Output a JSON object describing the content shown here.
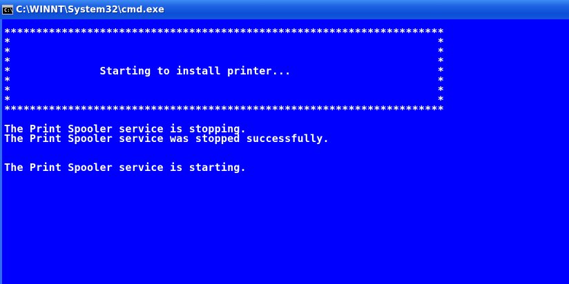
{
  "window": {
    "title": "C:\\WINNT\\System32\\cmd.exe",
    "icon": "cmd-console-icon",
    "background_color": "#0000ff",
    "text_color": "#ffffff"
  },
  "console": {
    "lines": [
      "*********************************************************************",
      "*                                                                   *",
      "*                                                                   *",
      "*                                                                   *",
      "*              Starting to install printer...                       *",
      "*                                                                   *",
      "*                                                                   *",
      "*                                                                   *",
      "*********************************************************************",
      "",
      "The Print Spooler service is stopping.",
      "The Print Spooler service was stopped successfully.",
      "",
      "",
      "The Print Spooler service is starting."
    ]
  }
}
